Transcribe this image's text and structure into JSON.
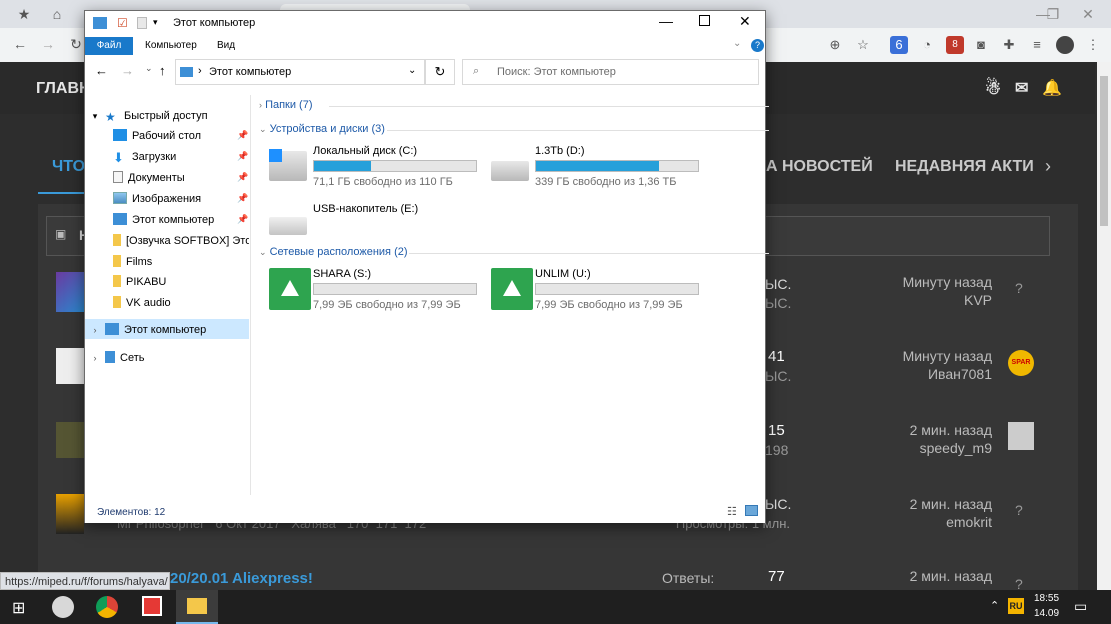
{
  "browser": {
    "status_url": "https://miped.ru/f/forums/halyava/"
  },
  "forum": {
    "header_title": "ГЛАВН",
    "tab_first": "ЧТО",
    "tab_news": "А НОВОСТЕЙ",
    "tab_recent": "НЕДАВНЯЯ АКТИ",
    "section_letter": "Н",
    "rows": [
      {
        "stat_top": "ЫС.",
        "stat_bottom": "ЫС.",
        "time": "Минуту назад",
        "user": "KVP",
        "avatar": "?"
      },
      {
        "stat_top": "41",
        "stat_bottom": "ЫС.",
        "time": "Минуту назад",
        "user": "Иван7081",
        "avatar": "SPAR"
      },
      {
        "stat_top": "15",
        "stat_bottom": "198",
        "time": "2 мин. назад",
        "user": "speedy_m9",
        "avatar": ""
      },
      {
        "stat_top": "ЫС.",
        "stat_bottom": "Просмотры: 1 млн.",
        "time": "2 мин. назад",
        "user": "emokrit",
        "avatar": "?"
      },
      {
        "stat_top": "77",
        "stat_bottom": "Ответы:",
        "time": "2 мин. назад",
        "user": "",
        "avatar": "?"
      }
    ],
    "row4_meta": "Mr Philosopher   6 Окт 2017   Халява   170  171  172",
    "last_title": "20/20.01 Aliexpress!"
  },
  "explorer": {
    "title": "Этот компьютер",
    "ribbon_tabs": [
      "Файл",
      "Компьютер",
      "Вид"
    ],
    "address": "Этот компьютер",
    "search_placeholder": "Поиск: Этот компьютер",
    "nav": {
      "quick_access": "Быстрый доступ",
      "items": [
        "Рабочий стол",
        "Загрузки",
        "Документы",
        "Изображения",
        "Этот компьютер",
        "[Озвучка SOFTBOX] Это т",
        "Films",
        "PIKABU",
        "VK audio"
      ],
      "this_pc": "Этот компьютер",
      "network": "Сеть"
    },
    "groups": {
      "folders": "Папки (7)",
      "devices": "Устройства и диски (3)",
      "network": "Сетевые расположения (2)"
    },
    "drives": [
      {
        "name": "Локальный диск (C:)",
        "free": "71,1 ГБ свободно из 110 ГБ",
        "used": 0.354
      },
      {
        "name": "1.3Tb (D:)",
        "free": "339 ГБ свободно из 1,36 ТБ",
        "used": 0.757
      },
      {
        "name": "USB-накопитель (E:)",
        "free": "",
        "used": 0
      }
    ],
    "net_drives": [
      {
        "name": "SHARA (S:)",
        "free": "7,99 ЭБ свободно из 7,99 ЭБ",
        "used": 0
      },
      {
        "name": "UNLIM (U:)",
        "free": "7,99 ЭБ свободно из 7,99 ЭБ",
        "used": 0
      }
    ],
    "status": "Элементов: 12"
  },
  "taskbar": {
    "lang": "RU",
    "time": "18:55",
    "date": "14.09"
  },
  "colors": {
    "accent": "#26a0da",
    "forum_bg": "#2d2d2d"
  }
}
